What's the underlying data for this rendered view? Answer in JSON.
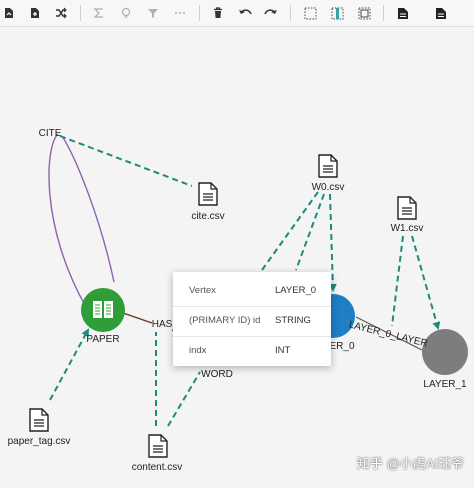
{
  "toolbar": {
    "buttons": [
      {
        "name": "load-icon-button"
      },
      {
        "name": "upload-icon-button"
      },
      {
        "name": "shuffle-icon-button"
      },
      {
        "name": "sum-icon-button"
      },
      {
        "name": "bulb-icon-button"
      },
      {
        "name": "filter-icon-button"
      },
      {
        "name": "more-icon-button"
      },
      {
        "name": "delete-icon-button"
      },
      {
        "name": "undo-icon-button"
      },
      {
        "name": "redo-icon-button"
      },
      {
        "name": "select-box-button"
      },
      {
        "name": "split-view-button"
      },
      {
        "name": "frame-button"
      },
      {
        "name": "document-button"
      },
      {
        "name": "document-alt-button"
      }
    ]
  },
  "graph": {
    "vertices": {
      "paper": "PAPER",
      "word": "WORD",
      "layer_0": "LAYER_0",
      "layer_1": "LAYER_1",
      "layer_0_partial": "ER_0"
    },
    "edges": {
      "cite": "CITE",
      "has": "HAS",
      "layer_0_layer": "LAYER_0_LAYER"
    },
    "files": {
      "cite_csv": "cite.csv",
      "w0_csv": "W0.csv",
      "w1_csv": "W1.csv",
      "paper_tag_csv": "paper_tag.csv",
      "content_csv": "content.csv"
    }
  },
  "popup": {
    "header_key": "Vertex",
    "header_value": "LAYER_0",
    "rows": [
      {
        "key": "(PRIMARY ID) id",
        "value": "STRING"
      },
      {
        "key": "indx",
        "value": "INT"
      }
    ]
  },
  "watermark": "知乎 @小虎AI珏爷",
  "colors": {
    "paper_vertex": "#2f9e38",
    "layer_0_vertex": "#1e7fc4",
    "layer_1_vertex": "#7d7d7d",
    "mapping_arrow": "#1d8a7a",
    "cite_edge": "#8e63b0",
    "has_edge": "#6b3a2e"
  }
}
